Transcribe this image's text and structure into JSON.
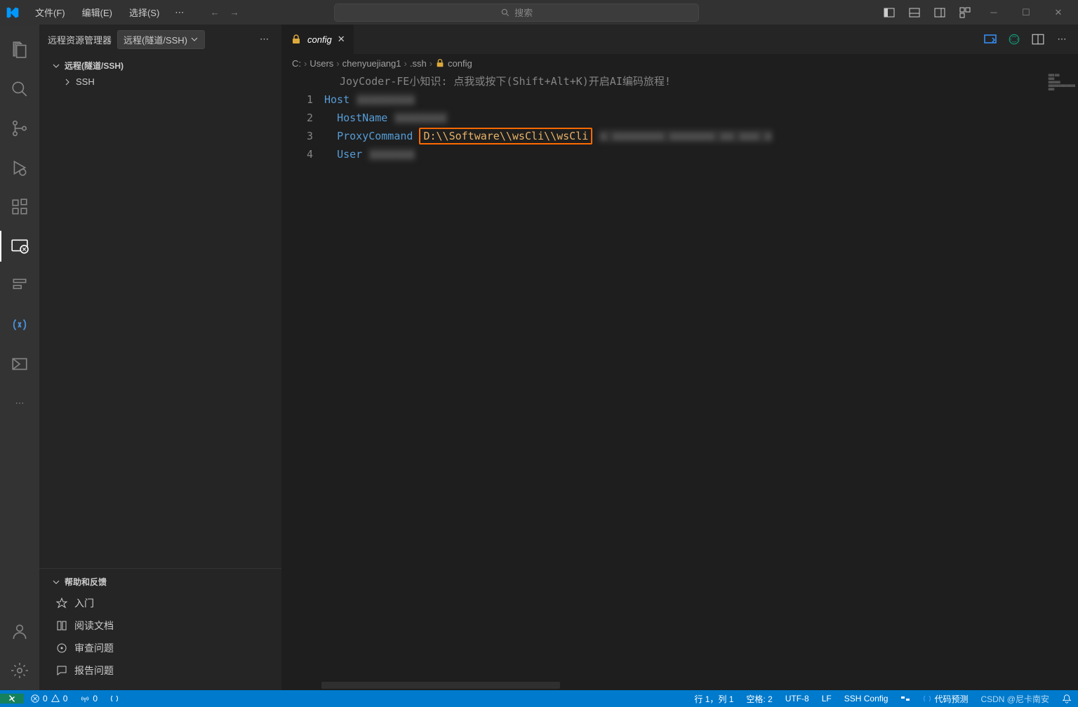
{
  "titlebar": {
    "menus": [
      "文件(F)",
      "编辑(E)",
      "选择(S)"
    ],
    "search_placeholder": "搜索"
  },
  "sidebar": {
    "title": "远程资源管理器",
    "dropdown": "远程(隧道/SSH)",
    "tree_section": "远程(隧道/SSH)",
    "tree_item": "SSH",
    "help": {
      "header": "帮助和反馈",
      "items": [
        "入门",
        "阅读文档",
        "审查问题",
        "报告问题"
      ]
    }
  },
  "editor": {
    "tab": "config",
    "breadcrumb": [
      "C:",
      "Users",
      "chenyuejiang1",
      ".ssh",
      "config"
    ],
    "hint": "JoyCoder-FE小知识: 点我或按下(Shift+Alt+K)开启AI编码旅程!",
    "lines": {
      "l1_kw": "Host",
      "l2_kw": "HostName",
      "l3_kw": "ProxyCommand",
      "l3_highlight": "D:\\\\Software\\\\wsCli\\\\wsCli",
      "l4_kw": "User"
    }
  },
  "status": {
    "errors": "0",
    "warnings": "0",
    "ports": "0",
    "position": "行 1，列 1",
    "spaces": "空格: 2",
    "encoding": "UTF-8",
    "eol": "LF",
    "lang": "SSH Config",
    "predict": "代码预测",
    "watermark": "CSDN @尼卡南安"
  }
}
